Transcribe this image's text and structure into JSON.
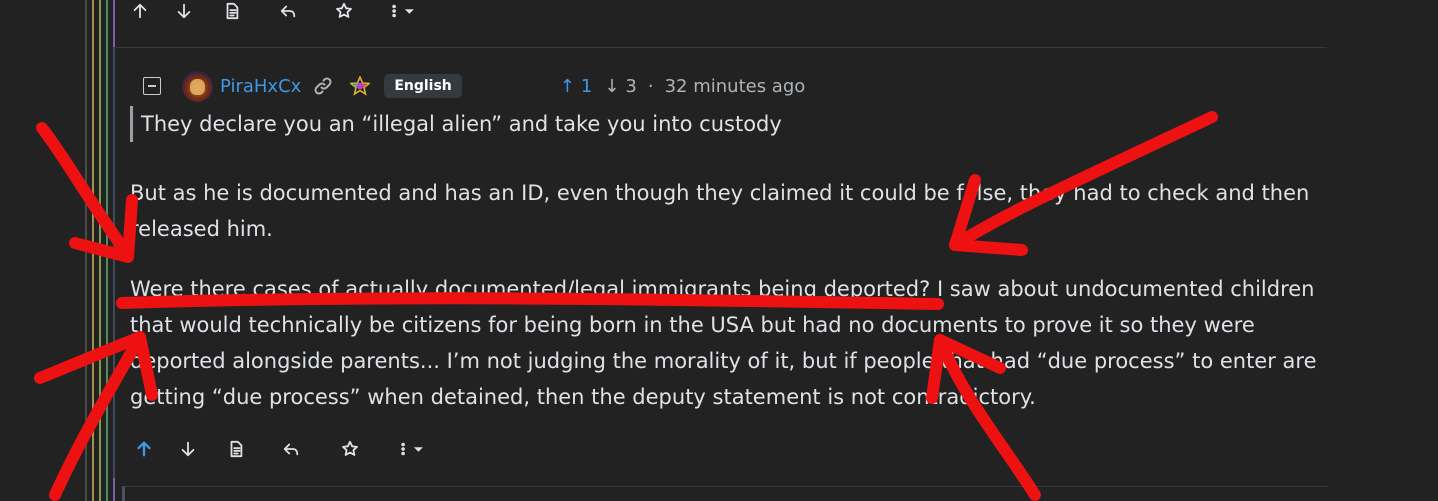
{
  "top_actions": {
    "icons": [
      "upvote-icon",
      "downvote-icon",
      "view-source-icon",
      "reply-icon",
      "save-star-icon",
      "more-options-icon"
    ]
  },
  "comment": {
    "username": "PiraHxCx",
    "language": "English",
    "upvote_count": "1",
    "downvote_count": "3",
    "separator": "·",
    "timestamp": "32 minutes ago",
    "quote": "They declare you an “illegal alien” and take you into custody",
    "paragraphs": [
      "But as he is documented and has an ID, even though they claimed it could be false, they had to check and then released him.",
      "Were there cases of actually documented/legal immigrants being deported? I saw about undocumented children that would technically be citizens for being born in the USA but had no documents to prove it so they were deported alongside parents... I’m not judging the morality of it, but if people that had “due process” to enter are getting “due process” when detained, then the deputy statement is not contradictory."
    ],
    "upvoted": true
  },
  "colors": {
    "background": "#222222",
    "text": "#dee2e6",
    "link_blue": "#3f97e5",
    "muted": "#aeb3b8",
    "badge_bg": "#343a40",
    "annotation_red": "#ee1111"
  },
  "icons": {
    "arrow_up": "↑",
    "arrow_down": "↓"
  }
}
